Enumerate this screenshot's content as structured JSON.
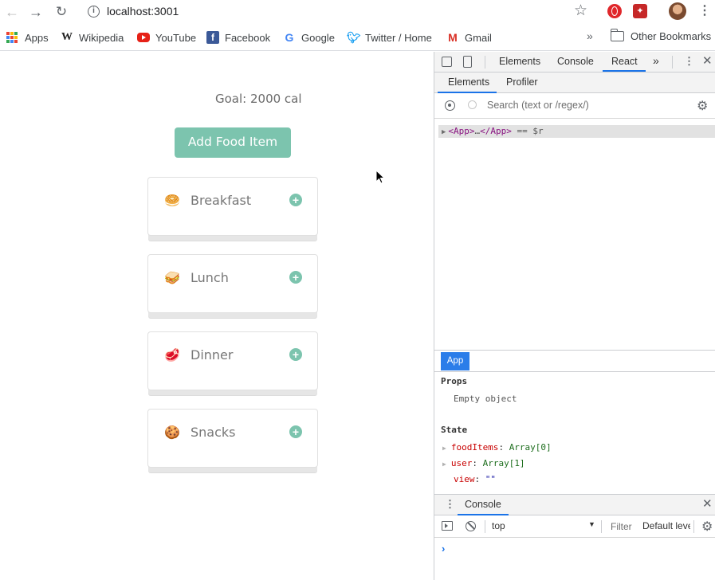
{
  "browser": {
    "url": "localhost:3001",
    "bookmarks": [
      {
        "label": "Apps",
        "icon": "apps-grid-icon"
      },
      {
        "label": "Wikipedia",
        "icon": "wikipedia-icon"
      },
      {
        "label": "YouTube",
        "icon": "youtube-icon"
      },
      {
        "label": "Facebook",
        "icon": "facebook-icon"
      },
      {
        "label": "Google",
        "icon": "google-icon"
      },
      {
        "label": "Twitter / Home",
        "icon": "twitter-icon"
      },
      {
        "label": "Gmail",
        "icon": "gmail-icon"
      }
    ],
    "overflow": "»",
    "other_bookmarks": "Other Bookmarks"
  },
  "app": {
    "goal": "Goal: 2000 cal",
    "add_button": "Add Food Item",
    "meals": [
      {
        "label": "Breakfast",
        "icon": "🥯"
      },
      {
        "label": "Lunch",
        "icon": "🥪"
      },
      {
        "label": "Dinner",
        "icon": "🥩"
      },
      {
        "label": "Snacks",
        "icon": "🍪"
      }
    ],
    "accent": "#7cc4ae"
  },
  "devtools": {
    "tabs": {
      "elements": "Elements",
      "console": "Console",
      "react": "React"
    },
    "more": "»",
    "subtabs": {
      "elements": "Elements",
      "profiler": "Profiler"
    },
    "search_placeholder": "Search (text or /regex/)",
    "tree": {
      "open": "<App>",
      "ellipsis": "…",
      "close": "</App>",
      "suffix": "== $r"
    },
    "component_badge": "App",
    "props_title": "Props",
    "props_empty": "Empty object",
    "state_title": "State",
    "state": [
      {
        "key": "foodItems",
        "value": "Array[0]"
      },
      {
        "key": "user",
        "value": "Array[1]"
      },
      {
        "key": "view",
        "value": "\"\""
      }
    ],
    "drawer_tab": "Console",
    "context": "top",
    "filter": "Filter",
    "levels": "Default levels",
    "prompt": "›",
    "accent": "#1a73e8"
  }
}
